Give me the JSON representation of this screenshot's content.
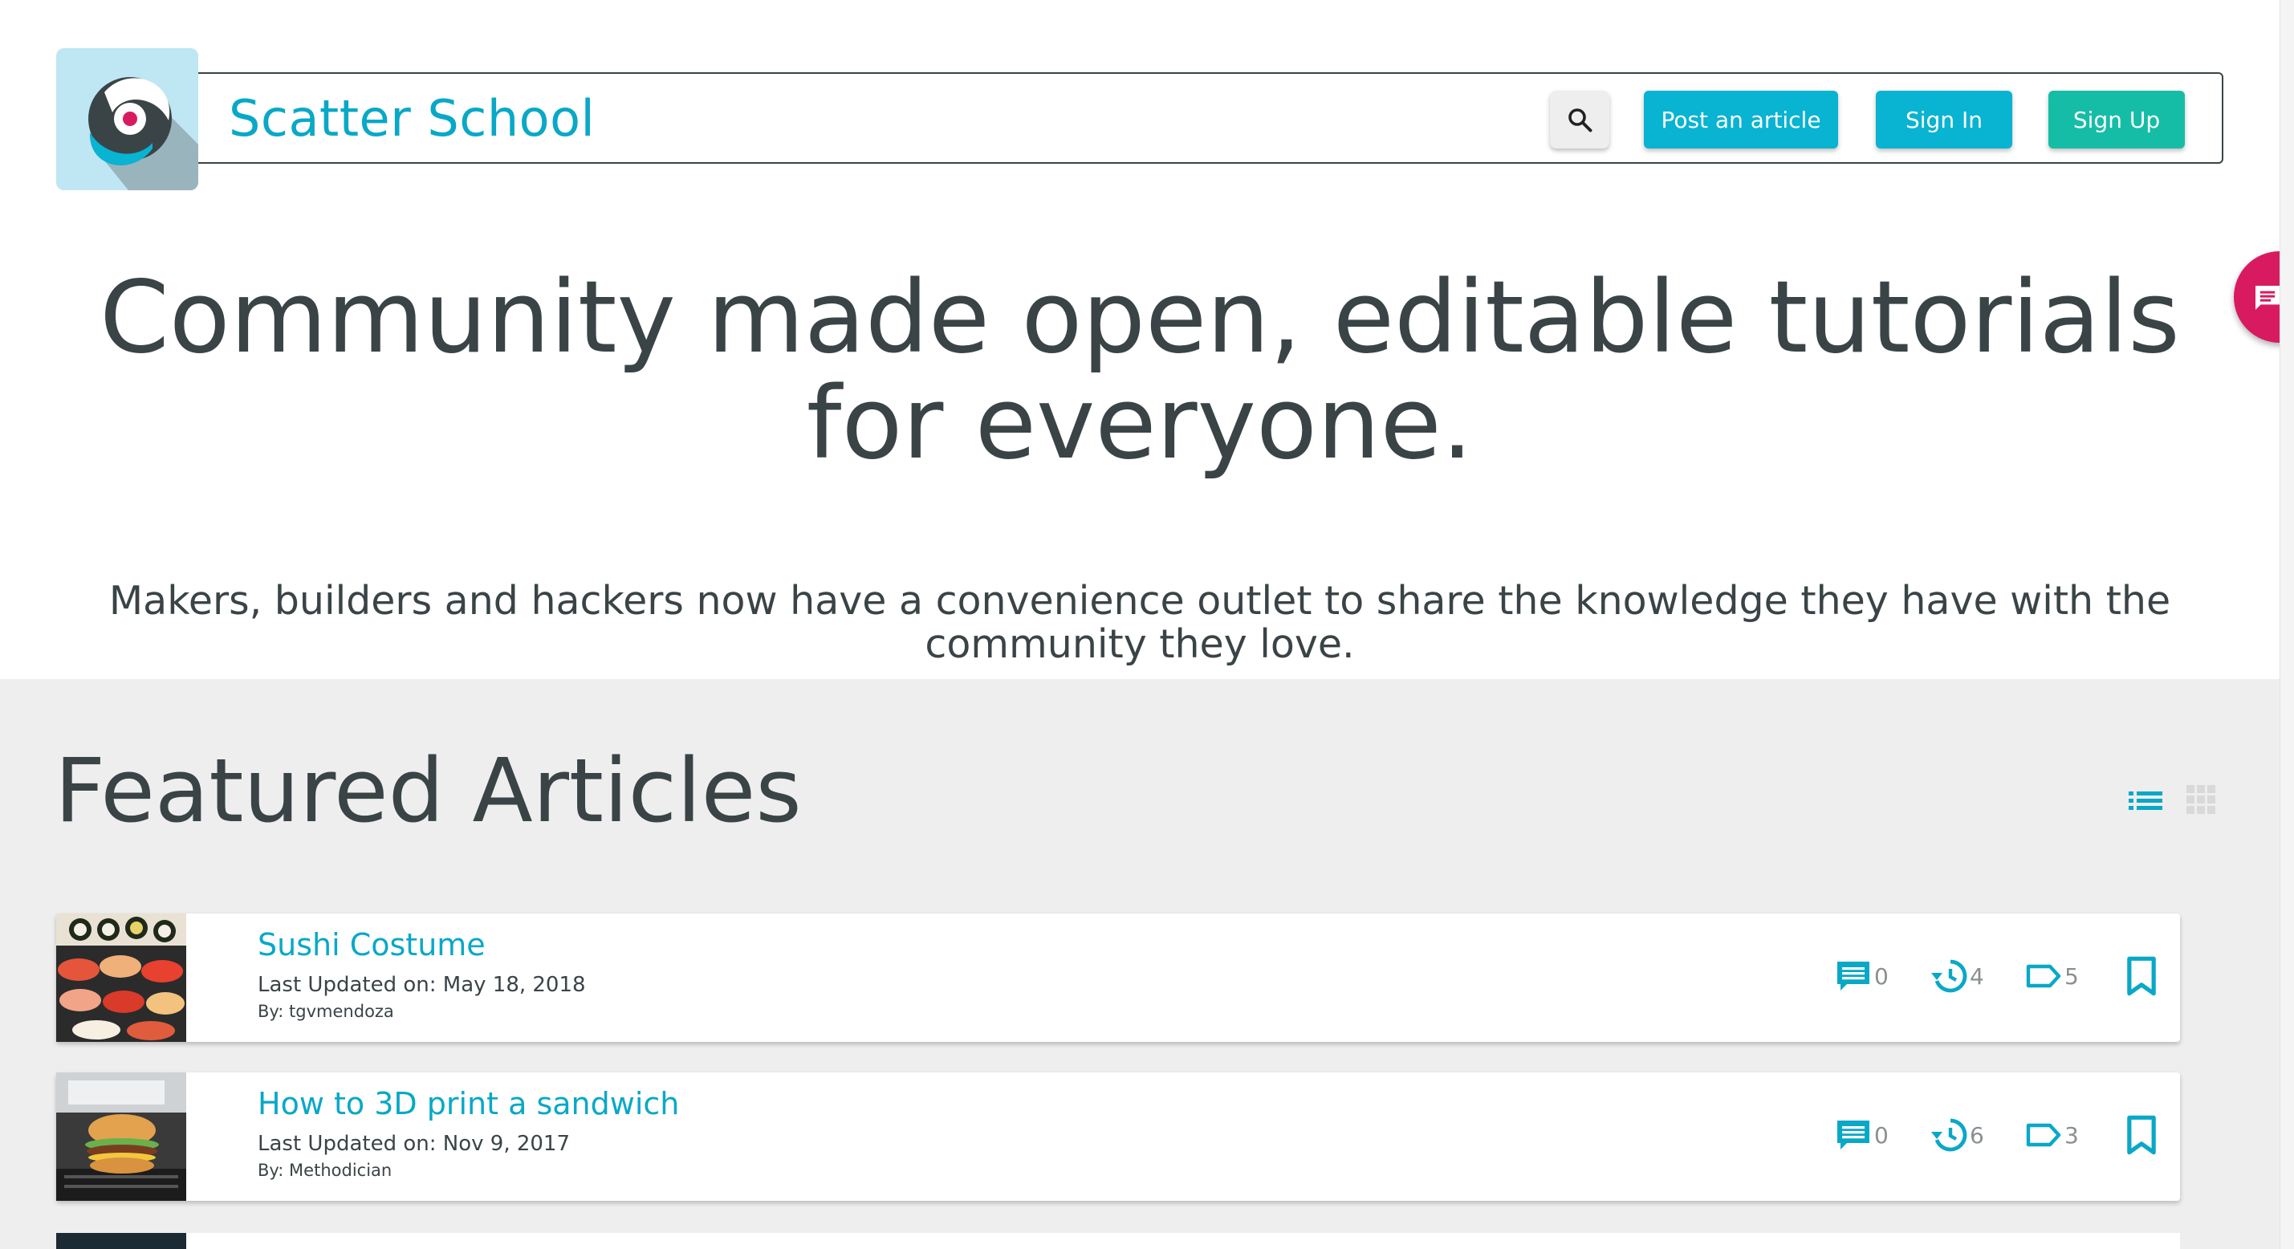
{
  "header": {
    "brand": "Scatter School",
    "post_label": "Post an article",
    "signin_label": "Sign In",
    "signup_label": "Sign Up"
  },
  "hero": {
    "title": "Community made open, editable tutorials for everyone.",
    "subtitle": "Makers, builders and hackers now have a convenience outlet to share the knowledge they have with the community they love."
  },
  "featured": {
    "title": "Featured Articles",
    "articles": [
      {
        "title": "Sushi Costume",
        "updated": "Last Updated on: May 18, 2018",
        "by": "By: tgvmendoza",
        "comments": "0",
        "revisions": "4",
        "tags": "5"
      },
      {
        "title": "How to 3D print a sandwich",
        "updated": "Last Updated on: Nov 9, 2017",
        "by": "By: Methodician",
        "comments": "0",
        "revisions": "6",
        "tags": "3"
      }
    ]
  },
  "colors": {
    "accent": "#09a8c7",
    "signup": "#16bda6",
    "fab": "#d81b60",
    "text": "#3a4447"
  },
  "icons": [
    "search-icon",
    "chat-icon",
    "list-view-icon",
    "grid-view-icon",
    "comment-icon",
    "history-icon",
    "tag-icon",
    "bookmark-icon"
  ]
}
